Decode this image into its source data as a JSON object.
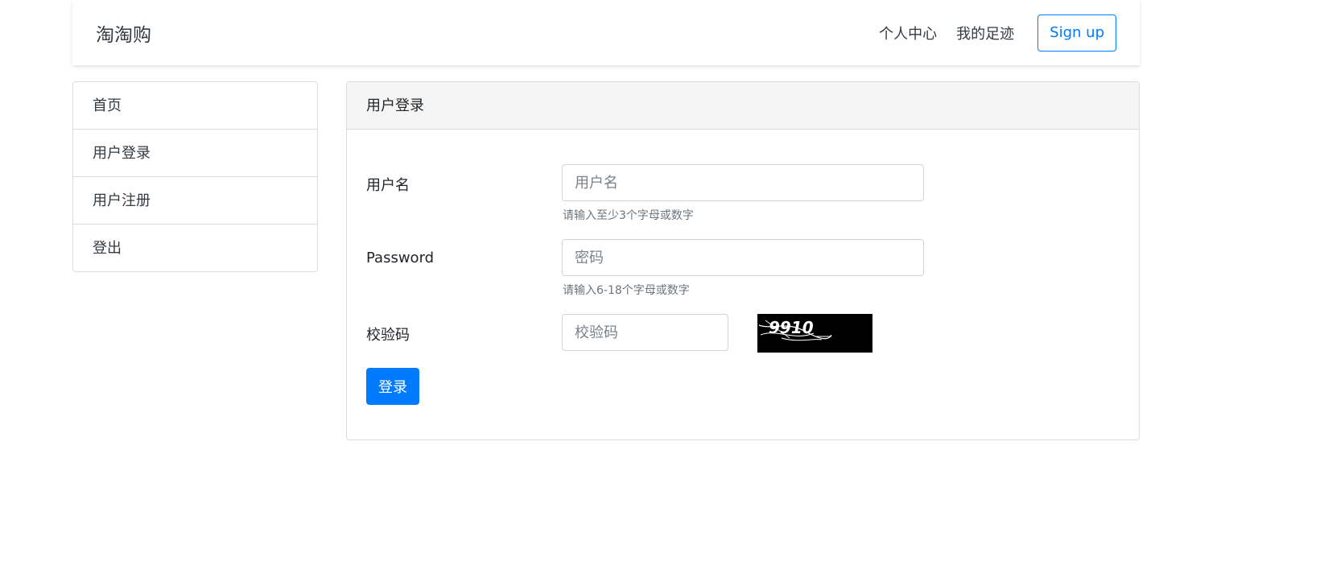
{
  "navbar": {
    "brand": "淘淘购",
    "links": [
      "个人中心",
      "我的足迹"
    ],
    "signup_label": "Sign up"
  },
  "sidebar": {
    "items": [
      {
        "label": "首页"
      },
      {
        "label": "用户登录"
      },
      {
        "label": "用户注册"
      },
      {
        "label": "登出"
      }
    ]
  },
  "login_card": {
    "title": "用户登录",
    "username": {
      "label": "用户名",
      "placeholder": "用户名",
      "help": "请输入至少3个字母或数字"
    },
    "password": {
      "label": "Password",
      "placeholder": "密码",
      "help": "请输入6-18个字母或数字"
    },
    "captcha": {
      "label": "校验码",
      "placeholder": "校验码",
      "image_text": "9910"
    },
    "submit_label": "登录"
  },
  "colors": {
    "primary": "#007bff",
    "card_header_bg": "#f5f5f5",
    "border": "#dcdcdc"
  }
}
